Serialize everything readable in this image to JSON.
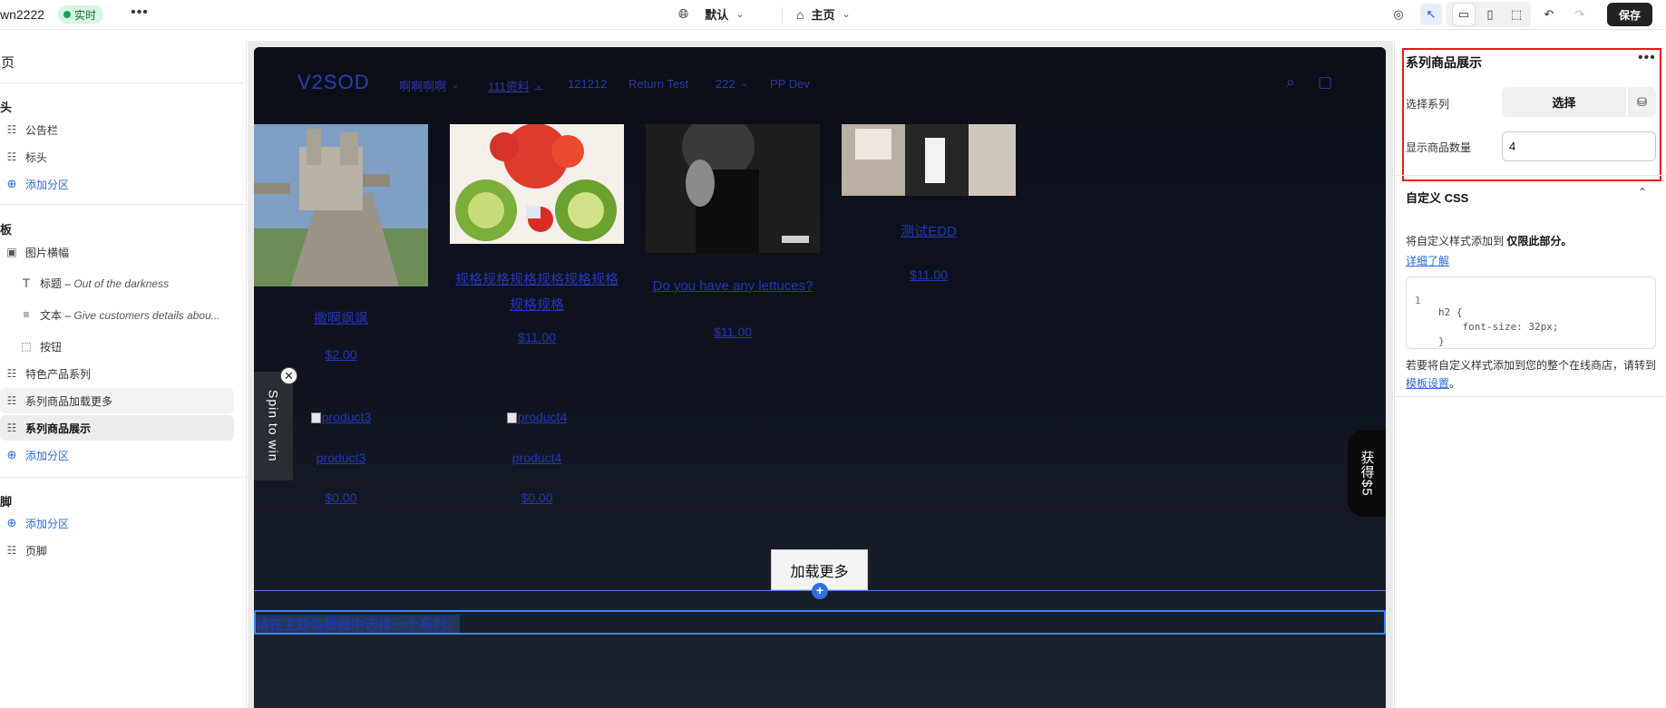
{
  "topbar": {
    "shop_name": "wn2222",
    "live_label": "实时",
    "theme_label": "默认",
    "page_label": "主页",
    "save_label": "保存"
  },
  "sidebar": {
    "title": "主页",
    "header_group": "页头",
    "header_items": [
      "公告栏",
      "标头"
    ],
    "add_section_label": "添加分区",
    "template_group": "模板",
    "banner_label": "图片横幅",
    "banner_blocks": [
      {
        "label": "标题",
        "detail": "Out of the darkness"
      },
      {
        "label": "文本",
        "detail": "Give customers details abou..."
      },
      {
        "label": "按钮",
        "detail": ""
      }
    ],
    "template_items": [
      "特色产品系列",
      "系列商品加载更多",
      "系列商品展示"
    ],
    "footer_group": "页脚",
    "footer_item": "页脚"
  },
  "store": {
    "logo": "V2SOD",
    "nav": [
      {
        "label": "啊啊啊啊",
        "dropdown": true
      },
      {
        "label": "111资料",
        "dropdown": true,
        "current": true
      },
      {
        "label": "121212",
        "dropdown": false
      },
      {
        "label": "Return Test",
        "dropdown": false
      },
      {
        "label": "222",
        "dropdown": true
      },
      {
        "label": "PP Dev",
        "dropdown": false
      }
    ],
    "products": [
      {
        "title": "撒啊飒飒",
        "price": "$2.00"
      },
      {
        "title": "规格规格规格规格规格规格规格规格",
        "price": "$11.00"
      },
      {
        "title": "Do you have any lettuces?",
        "price": "$11.00"
      },
      {
        "title": "测试EDD",
        "price": "$11.00"
      }
    ],
    "product_row2": [
      {
        "image_alt": "product3",
        "title": "product3",
        "price": "$0.00"
      },
      {
        "image_alt": "product4",
        "title": "product4",
        "price": "$0.00"
      }
    ],
    "spin_tab": "Spin to win",
    "reward_tab": "获得$5",
    "load_more": "加载更多",
    "empty_collection_msg": "请在主题编辑器中选择一个系列。"
  },
  "settings": {
    "section_title": "系列商品展示",
    "collection_label": "选择系列",
    "select_button": "选择",
    "qty_label": "显示商品数量",
    "qty_value": "4",
    "custom_css_title": "自定义 CSS",
    "css_desc_prefix": "将自定义样式添加到 ",
    "css_desc_bold": "仅限此部分。",
    "learn_more": "详细了解",
    "code_lines": [
      {
        "ln": "1",
        "code": "h2 {"
      },
      {
        "ln": "",
        "code": "    font-size: 32px;"
      },
      {
        "ln": "",
        "code": "}"
      }
    ],
    "footer_text": "若要将自定义样式添加到您的整个在线商店，请转到",
    "footer_link": "模板设置",
    "footer_end": "。"
  }
}
